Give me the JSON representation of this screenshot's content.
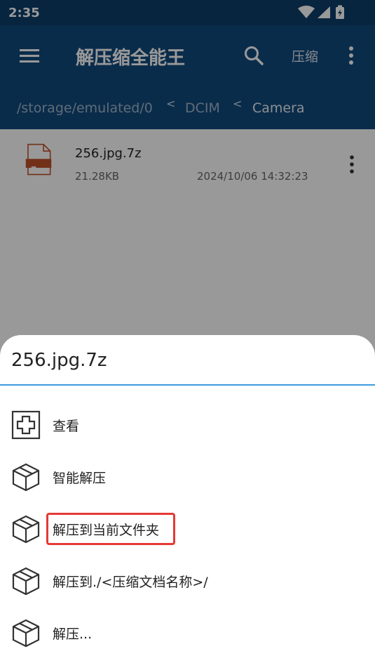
{
  "status_bar": {
    "time": "2:35"
  },
  "app_bar": {
    "title": "解压缩全能王",
    "compress_label": "压缩"
  },
  "path": {
    "segments": [
      "/storage/emulated/0",
      "DCIM",
      "Camera"
    ],
    "separator": "<"
  },
  "file_list": [
    {
      "name": "256.jpg.7z",
      "size": "21.28KB",
      "date": "2024/10/06 14:32:23",
      "badge": "7z"
    }
  ],
  "sheet": {
    "title": "256.jpg.7z",
    "items": [
      {
        "label": "查看",
        "icon": "plus-box-icon"
      },
      {
        "label": "智能解压",
        "icon": "package-icon"
      },
      {
        "label": "解压到当前文件夹",
        "icon": "package-icon",
        "highlighted": true
      },
      {
        "label": "解压到./<压缩文档名称>/",
        "icon": "package-icon"
      },
      {
        "label": "解压...",
        "icon": "package-icon"
      }
    ]
  },
  "colors": {
    "app_bar": "#114a7e",
    "status_bar": "#0d3f6a",
    "accent": "#3d9be0",
    "highlight": "#e53935",
    "file_badge": "#c0502a"
  }
}
